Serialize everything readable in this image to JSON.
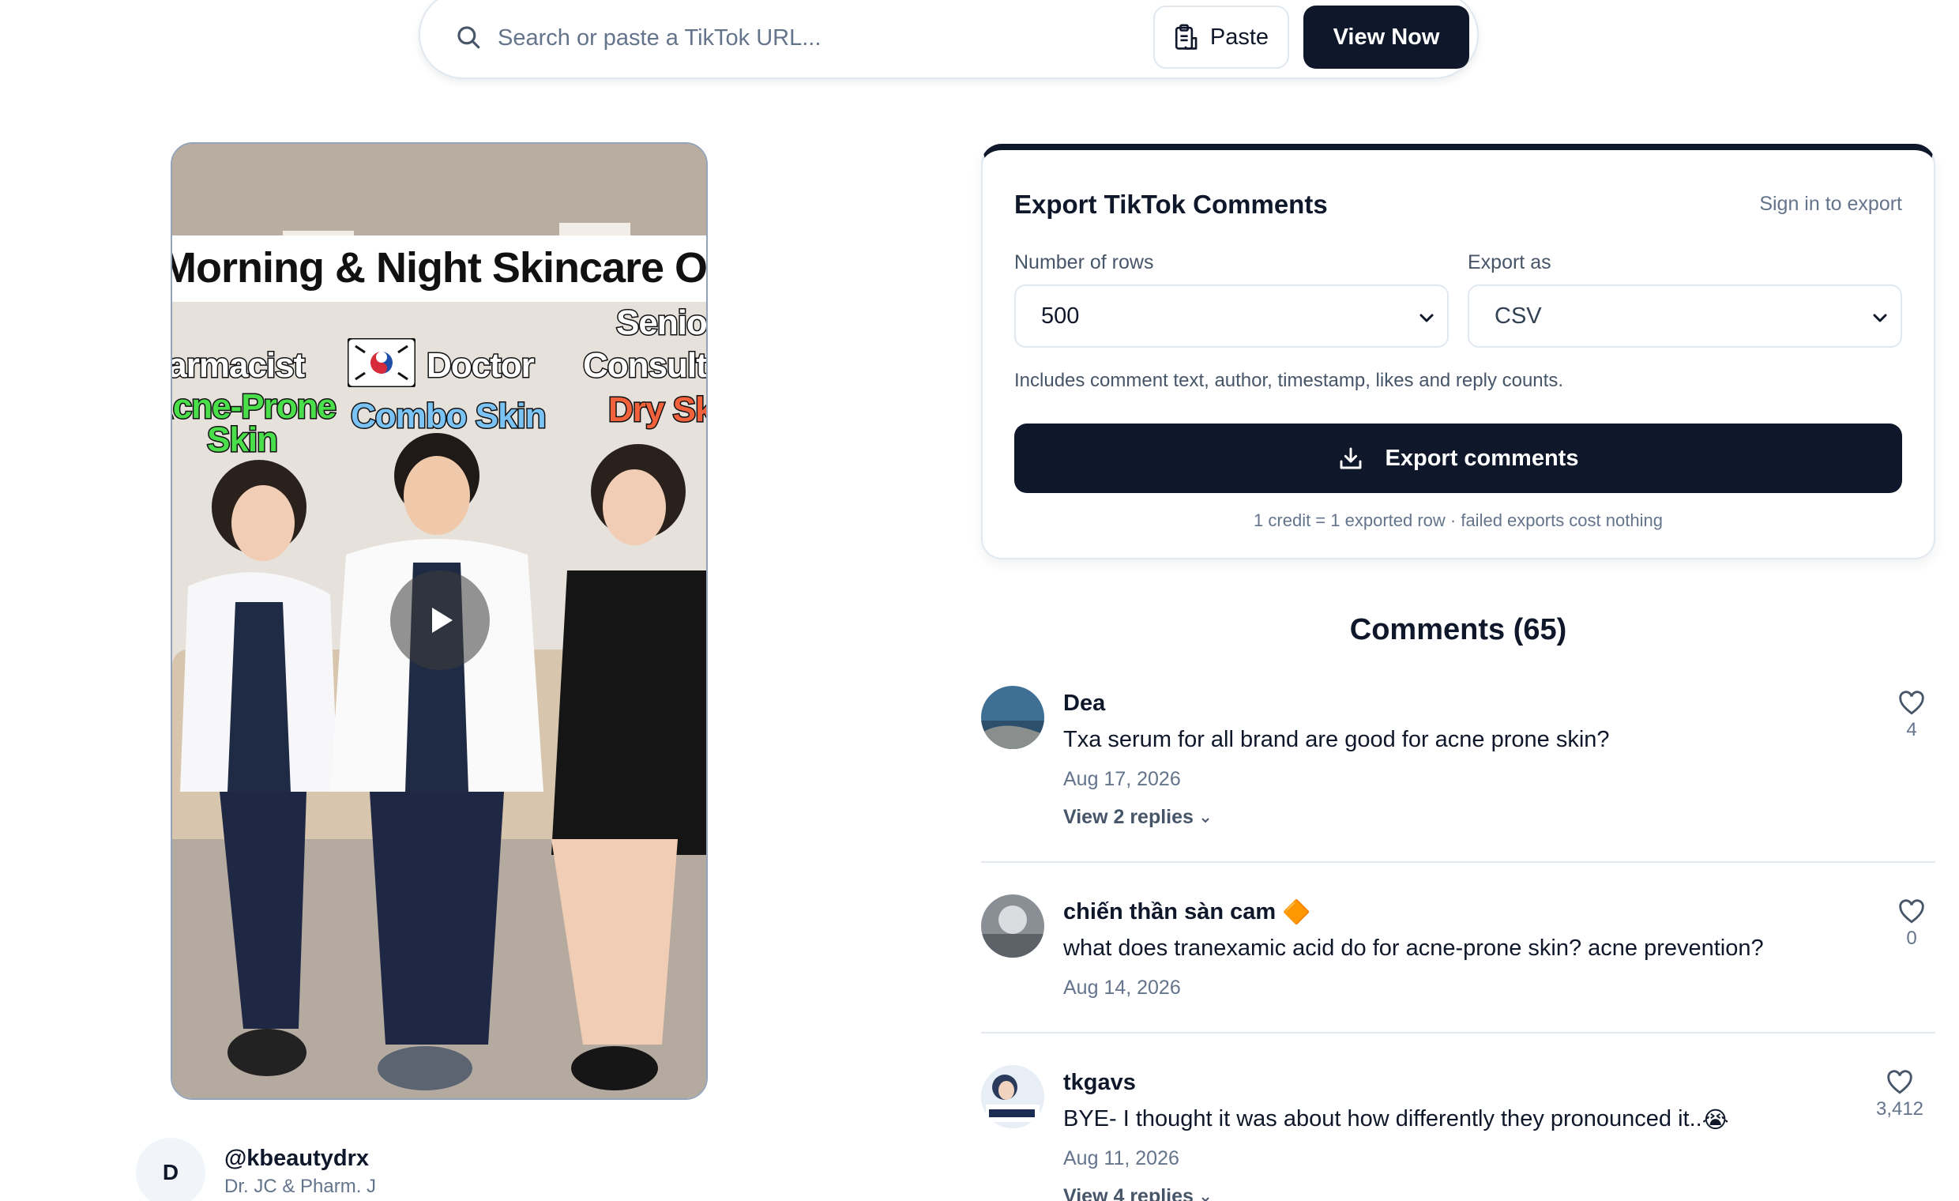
{
  "search": {
    "placeholder": "Search or paste a TikTok URL...",
    "paste_label": "Paste",
    "view_label": "View Now"
  },
  "video": {
    "title_text": "Morning & Night Skincare Order",
    "captions": {
      "left_role": "Pharmacist",
      "left_skin": "Acne-Prone\nSkin",
      "center_role": "Doctor",
      "center_skin": "Combo Skin",
      "right_role_1": "Senior",
      "right_role_2": "Consultant",
      "right_skin": "Dry Skin"
    }
  },
  "author": {
    "initial": "D",
    "handle": "@kbeautydrx",
    "name": "Dr. JC & Pharm. J"
  },
  "export": {
    "title": "Export TikTok Comments",
    "sign_in": "Sign in to export",
    "rows_label": "Number of rows",
    "rows_value": "500",
    "format_label": "Export as",
    "format_value": "CSV",
    "note": "Includes comment text, author, timestamp, likes and reply counts.",
    "button_label": "Export comments",
    "credit_note": "1 credit = 1 exported row · failed exports cost nothing"
  },
  "comments": {
    "title": "Comments (65)",
    "items": [
      {
        "author": "Dea",
        "text": "Txa serum for all brand are good for acne prone skin?",
        "date": "Aug 17, 2026",
        "likes": "4",
        "replies": "View 2 replies"
      },
      {
        "author": "chiến thần sàn cam",
        "author_badge": "🔶",
        "text": "what does tranexamic acid do for acne-prone skin? acne prevention?",
        "date": "Aug 14, 2026",
        "likes": "0",
        "replies": ""
      },
      {
        "author": "tkgavs",
        "text": "BYE- I thought it was about how differently they pronounced it..",
        "text_emoji": "😭",
        "date": "Aug 11, 2026",
        "likes": "3,412",
        "replies": "View 4 replies"
      }
    ]
  },
  "colors": {
    "primary": "#0f172a",
    "muted": "#64748b",
    "border": "#e2e8f0"
  },
  "icons": [
    "search-icon",
    "clipboard-icon",
    "download-icon",
    "chevron-down-icon",
    "heart-icon",
    "play-icon"
  ]
}
